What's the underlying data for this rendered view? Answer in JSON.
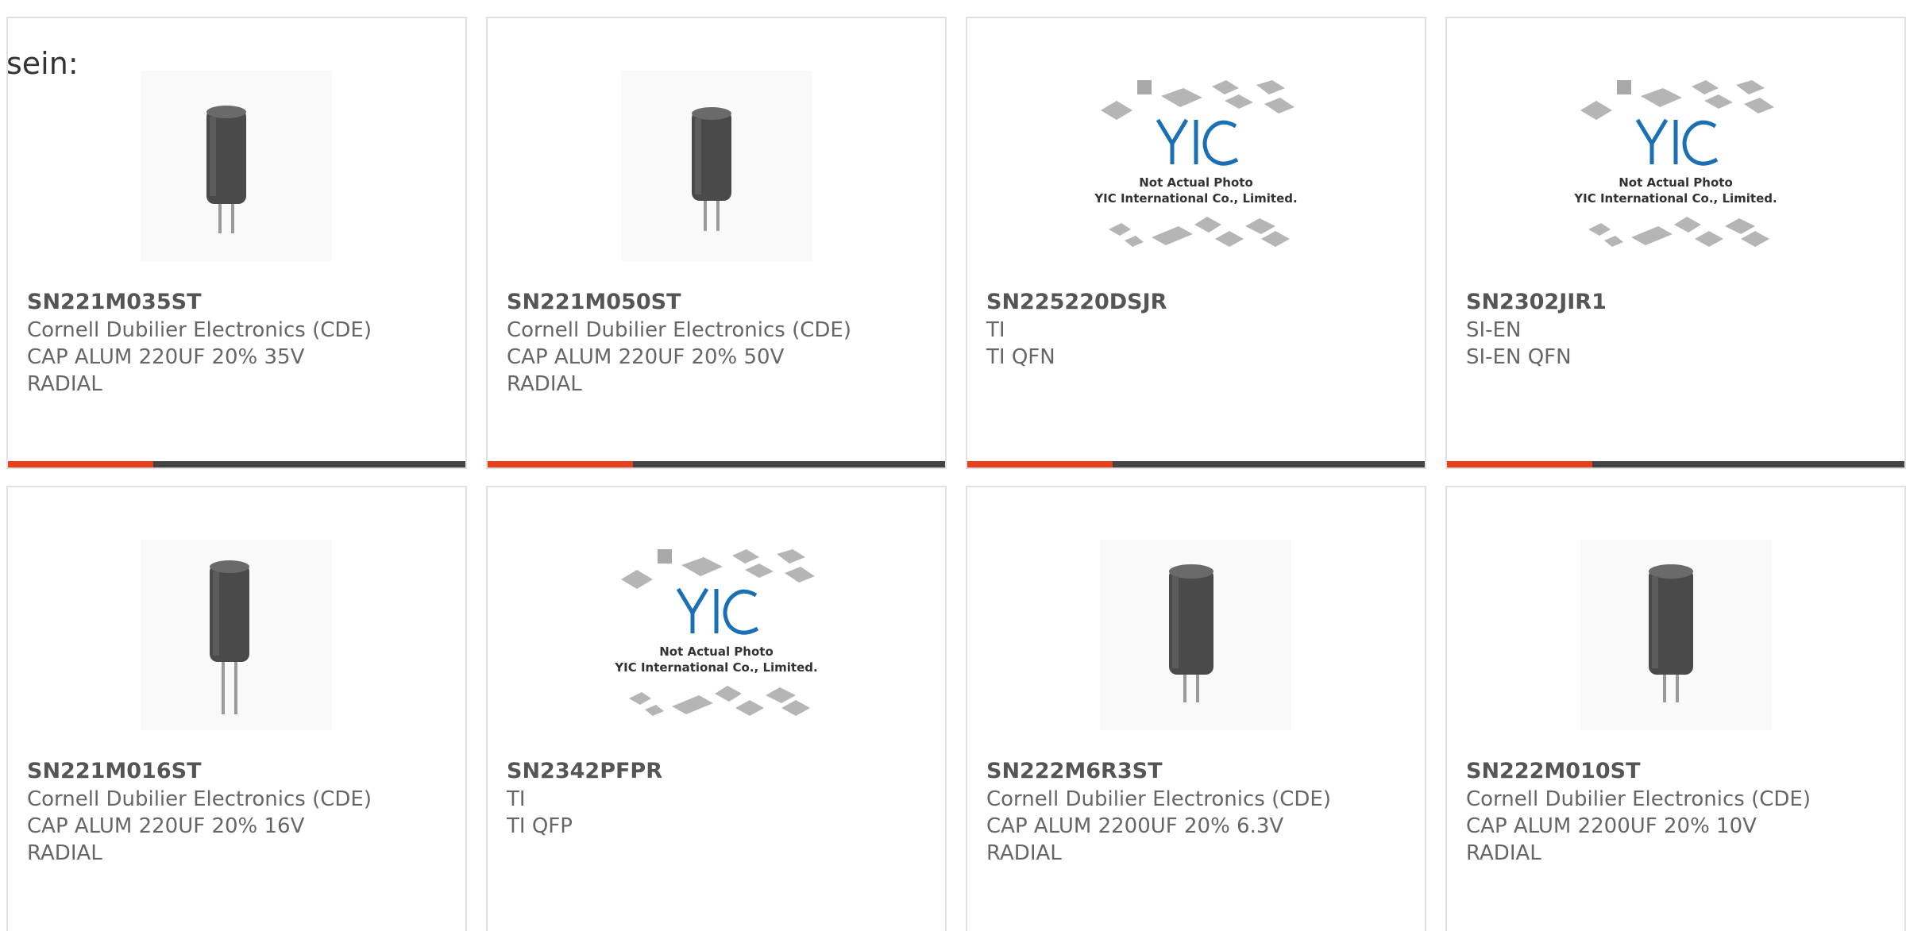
{
  "intro_text": "sein:",
  "products": [
    {
      "part": "SN221M035ST",
      "mfr": "Cornell Dubilier Electronics (CDE)",
      "desc": "CAP ALUM 220UF 20% 35V",
      "pkg": "RADIAL",
      "image": "capacitor-image"
    },
    {
      "part": "SN221M050ST",
      "mfr": "Cornell Dubilier Electronics (CDE)",
      "desc": "CAP ALUM 220UF 20% 50V",
      "pkg": "RADIAL",
      "image": "capacitor-image"
    },
    {
      "part": "SN225220DSJR",
      "mfr": "TI",
      "desc": "TI QFN",
      "pkg": "",
      "image": "placeholder-image"
    },
    {
      "part": "SN2302JIR1",
      "mfr": "SI-EN",
      "desc": "SI-EN QFN",
      "pkg": "",
      "image": "placeholder-image"
    },
    {
      "part": "SN221M016ST",
      "mfr": "Cornell Dubilier Electronics (CDE)",
      "desc": "CAP ALUM 220UF 20% 16V",
      "pkg": "RADIAL",
      "image": "capacitor-image"
    },
    {
      "part": "SN2342PFPR",
      "mfr": "TI",
      "desc": "TI QFP",
      "pkg": "",
      "image": "placeholder-image"
    },
    {
      "part": "SN222M6R3ST",
      "mfr": "Cornell Dubilier Electronics (CDE)",
      "desc": "CAP ALUM 2200UF 20% 6.3V",
      "pkg": "RADIAL",
      "image": "capacitor-image"
    },
    {
      "part": "SN222M010ST",
      "mfr": "Cornell Dubilier Electronics (CDE)",
      "desc": "CAP ALUM 2200UF 20% 10V",
      "pkg": "RADIAL",
      "image": "capacitor-image"
    }
  ],
  "placeholder": {
    "logo_text": "YIC",
    "line1": "Not Actual Photo",
    "line2": "YIC International Co., Limited."
  },
  "colors": {
    "accent": "#e8401c",
    "bar_dark": "#444444",
    "card_border": "#e1e1e1",
    "logo_blue": "#1a6fb5"
  }
}
